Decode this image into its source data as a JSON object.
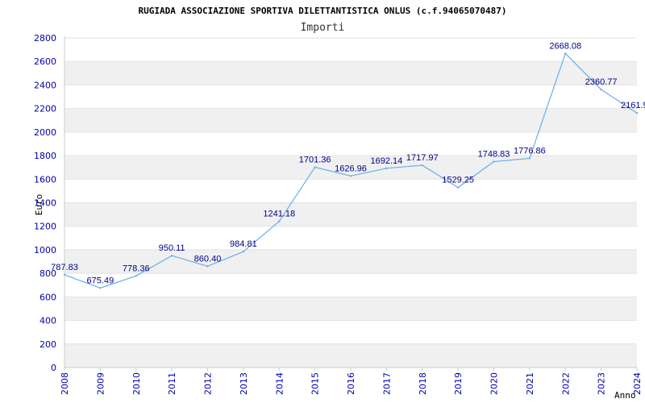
{
  "chart_data": {
    "type": "line",
    "title": "RUGIADA ASSOCIAZIONE SPORTIVA DILETTANTISTICA ONLUS (c.f.94065070487)",
    "subtitle": "Importi",
    "xlabel": "Anno",
    "ylabel": "Euro",
    "x": [
      "2008",
      "2009",
      "2010",
      "2011",
      "2012",
      "2013",
      "2014",
      "2015",
      "2016",
      "2017",
      "2018",
      "2019",
      "2020",
      "2021",
      "2022",
      "2023",
      "2024"
    ],
    "series": [
      {
        "values": [
          787.83,
          675.49,
          778.36,
          950.11,
          860.4,
          984.81,
          1241.18,
          1701.36,
          1626.96,
          1692.14,
          1717.97,
          1529.25,
          1748.83,
          1776.86,
          2668.08,
          2360.77,
          2161.9
        ],
        "labels": [
          "787.83",
          "675.49",
          "778.36",
          "950.11",
          "860.40",
          "984.81",
          "1241.18",
          "1701.36",
          "1626.96",
          "1692.14",
          "1717.97",
          "1529.25",
          "1748.83",
          "1776.86",
          "2668.08",
          "2360.77",
          "2161.9"
        ]
      }
    ],
    "ylim": [
      0,
      2800
    ],
    "yticks": [
      "0",
      "200",
      "400",
      "600",
      "800",
      "1000",
      "1200",
      "1400",
      "1600",
      "1800",
      "2000",
      "2200",
      "2400",
      "2600",
      "2800"
    ],
    "grid": true,
    "line_color": "#6aaee8",
    "band_color": "#f0f0f0",
    "tick_color": "#0000aa",
    "label_color": "#000088"
  }
}
